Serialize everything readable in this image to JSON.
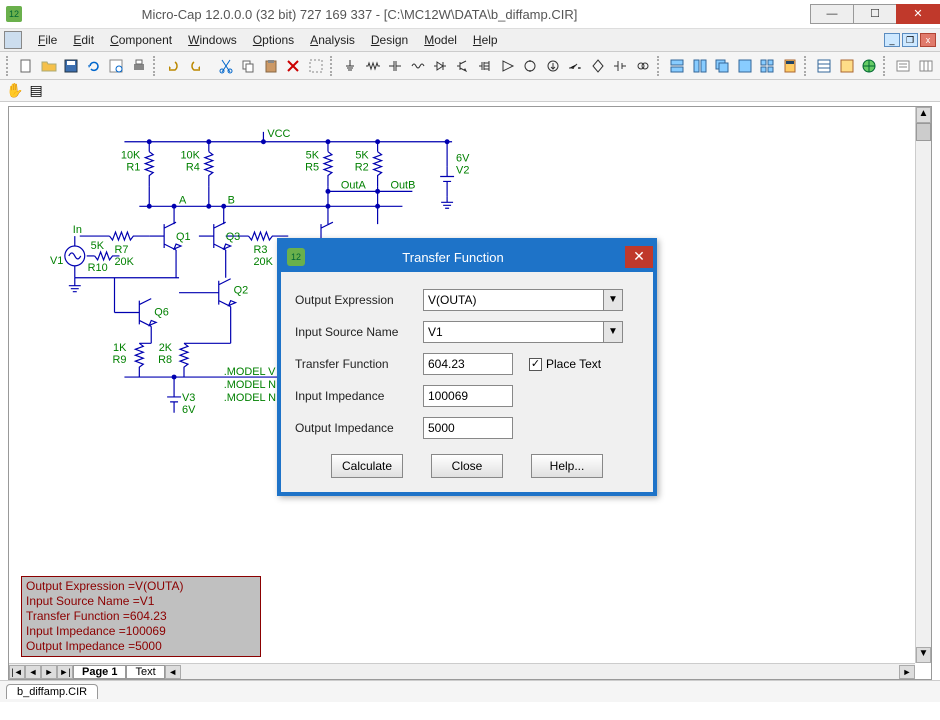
{
  "window": {
    "app_name": "Micro-Cap",
    "title": "Micro-Cap 12.0.0.0 (32 bit) 727 169 337 - [C:\\MC12W\\DATA\\b_diffamp.CIR]"
  },
  "menu": [
    "File",
    "Edit",
    "Component",
    "Windows",
    "Options",
    "Analysis",
    "Design",
    "Model",
    "Help"
  ],
  "toolbar2": {
    "pan_label": "✋",
    "select_label": "▦"
  },
  "schematic": {
    "labels": {
      "vcc": "VCC",
      "r1a": "10K",
      "r1b": "R1",
      "r4a": "10K",
      "r4b": "R4",
      "r5a": "5K",
      "r5b": "R5",
      "r2a": "5K",
      "r2b": "R2",
      "v2a": "6V",
      "v2b": "V2",
      "outA": "OutA",
      "outB": "OutB",
      "nodeA": "A",
      "nodeB": "B",
      "inlbl": "In",
      "r7a": "R7",
      "r7b": "20K",
      "r3a": "R3",
      "r3b": "20K",
      "v1": "V1",
      "r10a": "5K",
      "r10b": "R10",
      "q1": "Q1",
      "q3": "Q3",
      "q2": "Q2",
      "q6": "Q6",
      "r9a": "1K",
      "r9b": "R9",
      "r8a": "2K",
      "r8b": "R8",
      "v3a": "V3",
      "v3b": "6V",
      "model1": ".MODEL V",
      "model2": ".MODEL N",
      "model3": ".MODEL N"
    }
  },
  "dialog": {
    "title": "Transfer Function",
    "rows": {
      "output_expression_label": "Output Expression",
      "output_expression_value": "V(OUTA)",
      "input_source_label": "Input Source Name",
      "input_source_value": "V1",
      "transfer_function_label": "Transfer Function",
      "transfer_function_value": "604.23",
      "place_text_label": "Place Text",
      "input_impedance_label": "Input Impedance",
      "input_impedance_value": "100069",
      "output_impedance_label": "Output Impedance",
      "output_impedance_value": "5000"
    },
    "buttons": {
      "calculate": "Calculate",
      "close": "Close",
      "help": "Help..."
    }
  },
  "result_box": {
    "l1": "Output Expression =V(OUTA)",
    "l2": "Input Source Name =V1",
    "l3": "Transfer Function =604.23",
    "l4": "Input Impedance =100069",
    "l5": "Output Impedance =5000"
  },
  "page_tabs": {
    "page1": "Page 1",
    "text": "Text"
  },
  "doc_tab": "b_diffamp.CIR"
}
